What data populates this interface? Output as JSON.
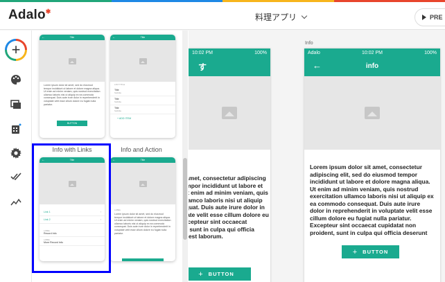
{
  "colors": {
    "accent": "#1aaa8f",
    "selection": "#0000ff",
    "brand_red": "#e8452c",
    "brand_yellow": "#f7b51c",
    "brand_green": "#21a67a",
    "brand_blue": "#1e88e5"
  },
  "header": {
    "logo": "Adalo",
    "app_name": "料理アプリ",
    "preview_label": "PRE"
  },
  "sidebar": {
    "items": [
      {
        "icon": "add-icon"
      },
      {
        "icon": "palette-icon"
      },
      {
        "icon": "screens-icon"
      },
      {
        "icon": "database-icon"
      },
      {
        "icon": "gear-icon"
      },
      {
        "icon": "publish-check-icon"
      },
      {
        "icon": "analytics-icon"
      }
    ]
  },
  "templates": {
    "cards": [
      {
        "label": "",
        "title": "Title",
        "body": "Lorem ipsum dolor sit amet, sed do eiusmod tempor incididunt ut labore et dolore magna aliqua. Ut enim ad minim veniam, quis nostrud exercitation ullamco laboris nisi ut aliquip ex ea commodo consequat. Duis aute irure dolor in reprehenderit in voluptate velit esse cillum dolore eu fugiat nulla pariatur.",
        "button": "BUTTON"
      },
      {
        "label": "",
        "title": "Title",
        "list": [
          {
            "title": "Title",
            "sub": "Subtitle"
          },
          {
            "title": "Title",
            "sub": "Subtitle"
          },
          {
            "title": "Title",
            "sub": "Subtitle"
          }
        ],
        "list_header": "LIST TITLE",
        "add": "ADD ITEM"
      },
      {
        "label": "Info with Links",
        "title": "Title",
        "links": [
          "Link 1",
          "Link 2"
        ],
        "records": [
          {
            "label": "LABEL",
            "value": "Record Info"
          },
          {
            "label": "LABEL",
            "value": "More Record Info"
          }
        ]
      },
      {
        "label": "Info and Action",
        "title": "Title",
        "body": "Lorem ipsum dolor sit amet, sed do eiusmod tempor incididunt ut labore et dolore magna aliqua. Ut enim ad minim veniam, quis nostrud exercitation ullamco laboris nisi ut aliquip ex ea commodo consequat. Duis aute irure dolor in reprehenderit in voluptate velit esse cillum dolore eu fugiat nulla pariatur.",
        "record_label": "LABEL"
      }
    ]
  },
  "canvas": {
    "screen1": {
      "time": "10:02 PM",
      "battery": "100%",
      "title": "す",
      "body": "Lorem ipsum dolor sit amet, consectetur adipiscing elit, sed do eiusmod tempor incididunt ut labore et dolore magna aliqua. Ut enim ad minim veniam, quis nostrud exercitation ullamco laboris nisi ut aliquip ex ea commodo consequat. Duis aute irure dolor in reprehenderit in voluptate velit esse cillum dolore eu fugiat nulla pariatur. Excepteur sint occaecat cupidatat non proident, sunt in culpa qui officia deserunt mollit anim id est laborum.",
      "button": "BUTTON"
    },
    "screen2": {
      "label": "Info",
      "carrier": "Adalo",
      "time": "10:02 PM",
      "battery": "100%",
      "title": "info",
      "body": "Lorem ipsum dolor sit amet, consectetur adipiscing elit, sed do eiusmod tempor incididunt ut labore et dolore magna aliqua. Ut enim ad minim veniam, quis nostrud exercitation ullamco laboris nisi ut aliquip ex ea commodo consequat. Duis aute irure dolor in reprehenderit in voluptate velit esse cillum dolore eu fugiat nulla pariatur. Excepteur sint occaecat cupidatat non proident, sunt in culpa qui officia deserunt mollit anim id est laborum.",
      "button": "BUTTON"
    }
  }
}
